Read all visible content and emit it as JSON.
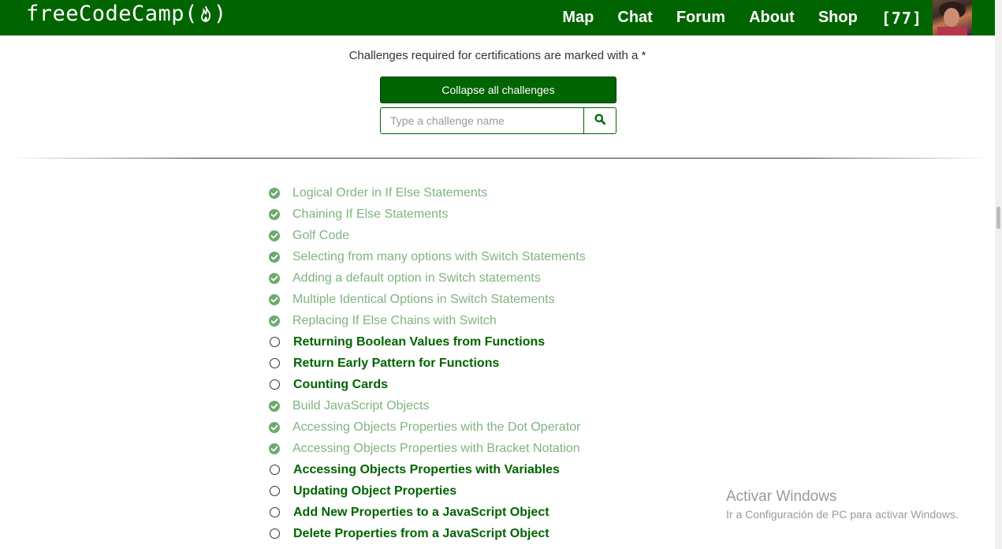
{
  "nav": {
    "brand_prefix": "freeCodeCamp(",
    "brand_suffix": ")",
    "links": [
      "Map",
      "Chat",
      "Forum",
      "About",
      "Shop"
    ],
    "points": "[77]"
  },
  "notice": "Challenges required for certifications are marked with a *",
  "collapse_label": "Collapse all challenges",
  "search": {
    "placeholder": "Type a challenge name"
  },
  "challenges": [
    {
      "title": "Logical Order in If Else Statements",
      "completed": true
    },
    {
      "title": "Chaining If Else Statements",
      "completed": true
    },
    {
      "title": "Golf Code",
      "completed": true
    },
    {
      "title": "Selecting from many options with Switch Statements",
      "completed": true
    },
    {
      "title": "Adding a default option in Switch statements",
      "completed": true
    },
    {
      "title": "Multiple Identical Options in Switch Statements",
      "completed": true
    },
    {
      "title": "Replacing If Else Chains with Switch",
      "completed": true
    },
    {
      "title": "Returning Boolean Values from Functions",
      "completed": false
    },
    {
      "title": "Return Early Pattern for Functions",
      "completed": false
    },
    {
      "title": "Counting Cards",
      "completed": false
    },
    {
      "title": "Build JavaScript Objects",
      "completed": true
    },
    {
      "title": "Accessing Objects Properties with the Dot Operator",
      "completed": true
    },
    {
      "title": "Accessing Objects Properties with Bracket Notation",
      "completed": true
    },
    {
      "title": "Accessing Objects Properties with Variables",
      "completed": false
    },
    {
      "title": "Updating Object Properties",
      "completed": false
    },
    {
      "title": "Add New Properties to a JavaScript Object",
      "completed": false
    },
    {
      "title": "Delete Properties from a JavaScript Object",
      "completed": false
    }
  ],
  "watermark": {
    "title": "Activar Windows",
    "subtitle": "Ir a Configuración de PC para activar Windows."
  },
  "colors": {
    "brand_green": "#006400",
    "completed_text": "#80b380",
    "completed_icon": "#6cab6c"
  },
  "icons": [
    "flame-icon",
    "search-icon",
    "check-circle-icon",
    "empty-circle-icon"
  ]
}
